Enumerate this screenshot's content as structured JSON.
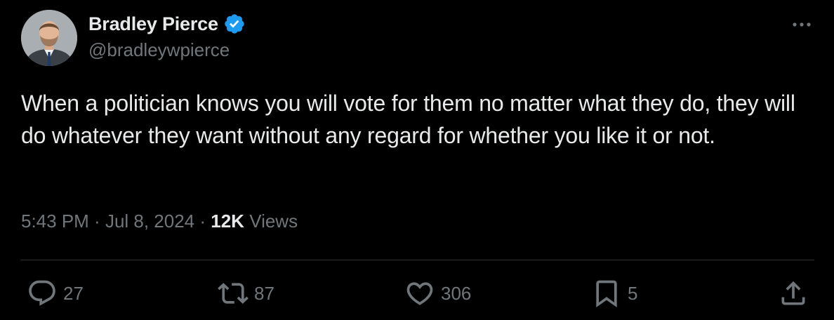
{
  "user": {
    "display_name": "Bradley Pierce",
    "handle": "@bradleywpierce",
    "verified": true,
    "verified_color": "#1d9bf0"
  },
  "tweet": {
    "text": "When a politician knows you will vote for them no matter what they do, they will do whatever they want without any regard for whether you like it or not.",
    "time": "5:43 PM",
    "separator": " · ",
    "date": "Jul 8, 2024",
    "views_count": "12K",
    "views_label": " Views"
  },
  "actions": {
    "replies": "27",
    "reposts": "87",
    "likes": "306",
    "bookmarks": "5"
  },
  "icons": {
    "more": "more-icon",
    "reply": "reply-icon",
    "repost": "repost-icon",
    "like": "heart-icon",
    "bookmark": "bookmark-icon",
    "share": "share-icon",
    "verified": "verified-badge-icon"
  },
  "colors": {
    "background": "#000000",
    "text_primary": "#e7e9ea",
    "text_secondary": "#71767b",
    "divider": "#2f3336"
  }
}
